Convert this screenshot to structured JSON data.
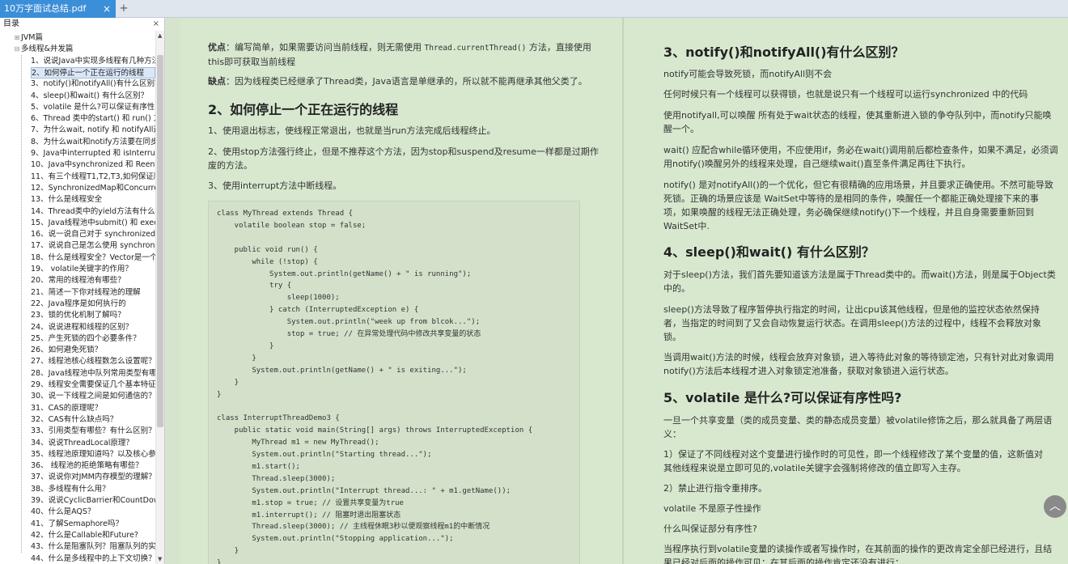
{
  "tab": {
    "title": "10万字面试总结.pdf",
    "close": "×",
    "new": "+"
  },
  "sidebar": {
    "header": "目录",
    "close": "×",
    "nodes": [
      {
        "label": "JVM篇",
        "tree": "⊞",
        "indent": 16
      },
      {
        "label": "多线程&并发篇",
        "tree": "⊟",
        "indent": 16
      },
      {
        "label": "1、说说Java中实现多线程有几种方法",
        "indent": 38
      },
      {
        "label": "2、如何停止一个正在运行的线程",
        "indent": 38,
        "selected": true
      },
      {
        "label": "3、notify()和notifyAll()有什么区别？",
        "indent": 38
      },
      {
        "label": "4、sleep()和wait() 有什么区别？",
        "indent": 38
      },
      {
        "label": "5、volatile 是什么?可以保证有序性吗?",
        "indent": 38
      },
      {
        "label": "6、Thread 类中的start() 和 run() 方法",
        "indent": 38
      },
      {
        "label": "7、为什么wait, notify 和 notifyAll这些",
        "indent": 38
      },
      {
        "label": "8、为什么wait和notify方法要在同步块",
        "indent": 38
      },
      {
        "label": "9、Java中interrupted 和 isInterrupte",
        "indent": 38
      },
      {
        "label": "10、Java中synchronized 和 Reentrar",
        "indent": 38
      },
      {
        "label": "11、有三个线程T1,T2,T3,如何保证顺序",
        "indent": 38
      },
      {
        "label": "12、SynchronizedMap和Concurrent",
        "indent": 38
      },
      {
        "label": "13、什么是线程安全",
        "indent": 38
      },
      {
        "label": "14、Thread类中的yield方法有什么作用",
        "indent": 38
      },
      {
        "label": "15、Java线程池中submit() 和 execute",
        "indent": 38
      },
      {
        "label": "16、说一说自己对于 synchronized 关",
        "indent": 38
      },
      {
        "label": "17、说说自己是怎么使用 synchronize",
        "indent": 38
      },
      {
        "label": "18、什么是线程安全？Vector是一个线",
        "indent": 38
      },
      {
        "label": "19、 volatile关键字的作用？",
        "indent": 38
      },
      {
        "label": "20、常用的线程池有哪些？",
        "indent": 38
      },
      {
        "label": "21、简述一下你对线程池的理解",
        "indent": 38
      },
      {
        "label": "22、Java程序是如何执行的",
        "indent": 38
      },
      {
        "label": "23、锁的优化机制了解吗？",
        "indent": 38
      },
      {
        "label": "24、说说进程和线程的区别？",
        "indent": 38
      },
      {
        "label": "25、产生死锁的四个必要条件？",
        "indent": 38
      },
      {
        "label": "26、如何避免死锁？",
        "indent": 38
      },
      {
        "label": "27、线程池核心线程数怎么设置呢？",
        "indent": 38
      },
      {
        "label": "28、Java线程池中队列常用类型有哪些",
        "indent": 38
      },
      {
        "label": "29、线程安全需要保证几个基本特征？",
        "indent": 38
      },
      {
        "label": "30、说一下线程之间是如何通信的？",
        "indent": 38
      },
      {
        "label": "31、CAS的原理呢？",
        "indent": 38
      },
      {
        "label": "32、CAS有什么缺点吗？",
        "indent": 38
      },
      {
        "label": "33、引用类型有哪些？有什么区别？",
        "indent": 38
      },
      {
        "label": "34、说说ThreadLocal原理？",
        "indent": 38
      },
      {
        "label": "35、线程池原理知道吗？以及核心参数",
        "indent": 38
      },
      {
        "label": "36、 线程池的拒绝策略有哪些？",
        "indent": 38
      },
      {
        "label": "37、说说你对JMM内存模型的理解？为",
        "indent": 38
      },
      {
        "label": "38、多线程有什么用？",
        "indent": 38
      },
      {
        "label": "39、说说CyclicBarrier和CountDownL",
        "indent": 38
      },
      {
        "label": "40、什么是AQS？",
        "indent": 38
      },
      {
        "label": "41、了解Semaphore吗？",
        "indent": 38
      },
      {
        "label": "42、什么是Callable和Future?",
        "indent": 38
      },
      {
        "label": "43、什么是阻塞队列？阻塞队列的实现",
        "indent": 38
      },
      {
        "label": "44、什么是多线程中的上下文切换？",
        "indent": 38
      }
    ]
  },
  "left": {
    "adv_label": "优点",
    "adv_a": "：编写简单，如果需要访问当前线程，则无需使用 ",
    "adv_code": "Thread.currentThread()",
    "adv_b": " 方法，直接使用",
    "adv_c": "this即可获取当前线程",
    "dis_label": "缺点",
    "dis": "：因为线程类已经继承了Thread类，Java语言是单继承的，所以就不能再继承其他父类了。",
    "h2": "2、如何停止一个正在运行的线程",
    "p1": "1、使用退出标志，使线程正常退出，也就是当run方法完成后线程终止。",
    "p2a": "2、使用stop方法强行终止，但是不推荐这个方法，因为stop和suspend及resume一样都是过期作",
    "p2b": "废的方法。",
    "p3": "3、使用interrupt方法中断线程。",
    "code": [
      "class MyThread extends Thread {",
      "    volatile boolean stop = false;",
      "",
      "    public void run() {",
      "        while (!stop) {",
      "            System.out.println(getName() + \" is running\");",
      "            try {",
      "                sleep(1000);",
      "            } catch (InterruptedException e) {",
      "                System.out.println(\"week up from blcok...\");",
      "                stop = true; // 在异常处理代码中修改共享变量的状态",
      "            }",
      "        }",
      "        System.out.println(getName() + \" is exiting...\");",
      "    }",
      "}",
      "",
      "class InterruptThreadDemo3 {",
      "    public static void main(String[] args) throws InterruptedException {",
      "        MyThread m1 = new MyThread();",
      "        System.out.println(\"Starting thread...\");",
      "        m1.start();",
      "        Thread.sleep(3000);",
      "        System.out.println(\"Interrupt thread...: \" + m1.getName());",
      "        m1.stop = true; // 设置共享变量为true",
      "        m1.interrupt(); // 阻塞时退出阻塞状态",
      "        Thread.sleep(3000); // 主线程休眠3秒以便观察线程m1的中断情况",
      "        System.out.println(\"Stopping application...\");",
      "    }",
      "}"
    ]
  },
  "right": {
    "h3": "3、notify()和notifyAll()有什么区别？",
    "r1": "notify可能会导致死锁，而notifyAll则不会",
    "r2": "任何时候只有一个线程可以获得锁，也就是说只有一个线程可以运行synchronized 中的代码",
    "r3a": "使用notifyall,可以唤醒 所有处于wait状态的线程，使其重新进入锁的争夺队列中，而notify只能唤",
    "r3b": "醒一个。",
    "r4a": "wait() 应配合while循环使用，不应使用if，务必在wait()调用前后都检查条件，如果不满足，必须调",
    "r4b": "用notify()唤醒另外的线程来处理，自己继续wait()直至条件满足再往下执行。",
    "r5a": "notify() 是对notifyAll()的一个优化，但它有很精确的应用场景，并且要求正确使用。不然可能导致",
    "r5b": "死锁。正确的场景应该是 WaitSet中等待的是相同的条件，唤醒任一个都能正确处理接下来的事",
    "r5c": "项，如果唤醒的线程无法正确处理，务必确保继续notify()下一个线程，并且自身需要重新回到",
    "r5d": "WaitSet中.",
    "h4": "4、sleep()和wait() 有什么区别？",
    "s1a": "对于sleep()方法，我们首先要知道该方法是属于Thread类中的。而wait()方法，则是属于Object类",
    "s1b": "中的。",
    "s2a": "sleep()方法导致了程序暂停执行指定的时间，让出cpu该其他线程，但是他的监控状态依然保持",
    "s2b": "者，当指定的时间到了又会自动恢复运行状态。在调用sleep()方法的过程中，线程不会释放对象",
    "s2c": "锁。",
    "s3a": "当调用wait()方法的时候，线程会放弃对象锁，进入等待此对象的等待锁定池，只有针对此对象调用",
    "s3b": "notify()方法后本线程才进入对象锁定池准备，获取对象锁进入运行状态。",
    "h5": "5、volatile 是什么?可以保证有序性吗?",
    "v1a": "一旦一个共享变量（类的成员变量、类的静态成员变量）被volatile修饰之后，那么就具备了两层语",
    "v1b": "义：",
    "v2a": "1）保证了不同线程对这个变量进行操作时的可见性，即一个线程修改了某个变量的值，这新值对",
    "v2b": "其他线程来说是立即可见的,volatile关键字会强制将修改的值立即写入主存。",
    "v3": "2）禁止进行指令重排序。",
    "v4": "volatile 不是原子性操作",
    "v5": "什么叫保证部分有序性?",
    "v6a": "当程序执行到volatile变量的读操作或者写操作时，在其前面的操作的更改肯定全部已经进行，且结",
    "v6b": "果已经对后面的操作可见；在其后面的操作肯定还没有进行；"
  },
  "fab": {
    "icon": "chevron-up-icon",
    "glyph": "︿"
  }
}
